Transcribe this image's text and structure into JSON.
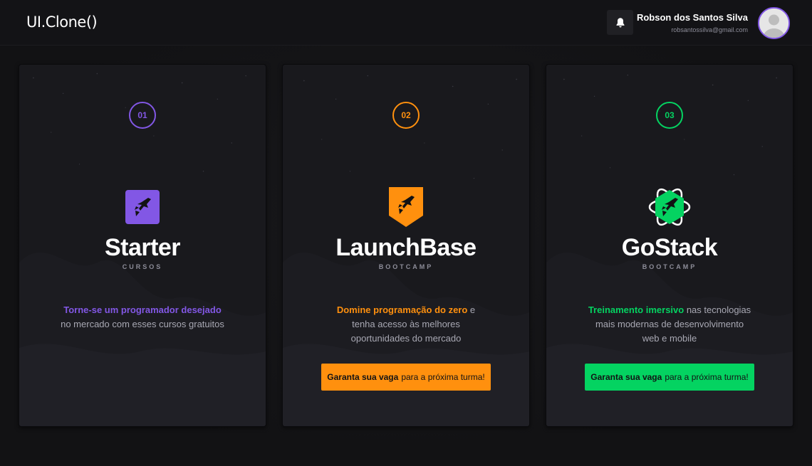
{
  "header": {
    "logo": "UI.Clone()",
    "user": {
      "name": "Robson dos Santos Silva",
      "email": "robsantossilva@gmail.com"
    }
  },
  "icons": {
    "bell": "bell-icon",
    "avatar": "user-avatar-icon",
    "rocket": "rocket-icon"
  },
  "cards": [
    {
      "step": "01",
      "title": "Starter",
      "subtitle": "CURSOS",
      "highlight": "Torne-se um programador desejado",
      "text": " no mercado com esses cursos gratuitos",
      "color": "#8257e5"
    },
    {
      "step": "02",
      "title": "LaunchBase",
      "subtitle": "BOOTCAMP",
      "highlight": "Domine programação do zero",
      "text": " e tenha acesso às melhores oportunidades do mercado",
      "color": "#ff900e",
      "cta_bold": "Garanta sua vaga",
      "cta_text": "para a próxima turma!"
    },
    {
      "step": "03",
      "title": "GoStack",
      "subtitle": "BOOTCAMP",
      "highlight": "Treinamento imersivo",
      "text": " nas tecnologias mais modernas de desenvolvimento web e mobile",
      "color": "#04d361",
      "cta_bold": "Garanta sua vaga",
      "cta_text": "para a próxima turma!"
    }
  ]
}
